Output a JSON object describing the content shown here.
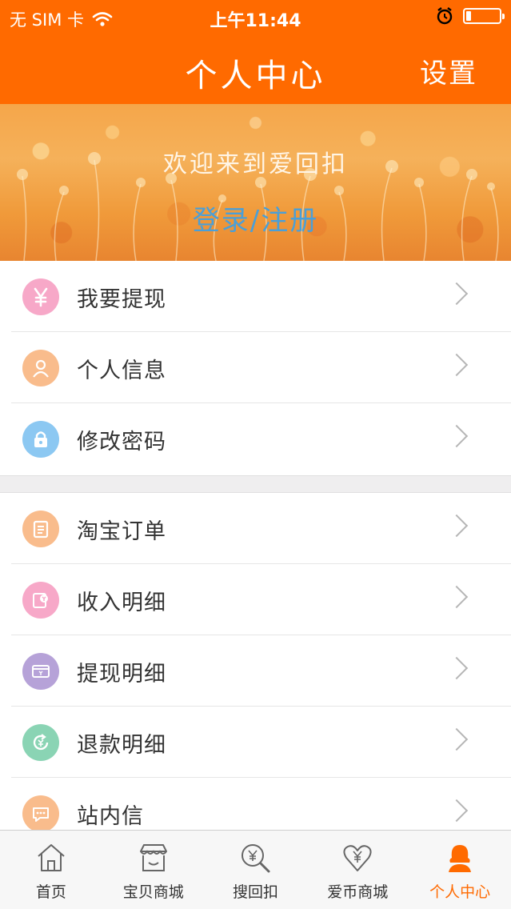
{
  "status_bar": {
    "carrier": "无 SIM 卡",
    "time": "上午11:44",
    "battery_level": 0.15
  },
  "nav": {
    "title": "个人中心",
    "settings_label": "设置"
  },
  "banner": {
    "welcome_text": "欢迎来到爱回扣",
    "login_label": "登录/注册"
  },
  "menu_group_1": [
    {
      "label": "我要提现",
      "icon": "yen-icon",
      "color": "#f7a8c8"
    },
    {
      "label": "个人信息",
      "icon": "user-icon",
      "color": "#f9bc8c"
    },
    {
      "label": "修改密码",
      "icon": "lock-icon",
      "color": "#8cc8f2"
    }
  ],
  "menu_group_2": [
    {
      "label": "淘宝订单",
      "icon": "clipboard-icon",
      "color": "#f9bc8c"
    },
    {
      "label": "收入明细",
      "icon": "income-icon",
      "color": "#f7a8c8"
    },
    {
      "label": "提现明细",
      "icon": "card-icon",
      "color": "#b6a2d8"
    },
    {
      "label": "退款明细",
      "icon": "refund-icon",
      "color": "#8ad4b4"
    },
    {
      "label": "站内信",
      "icon": "message-icon",
      "color": "#f9bc8c"
    }
  ],
  "tab_bar": [
    {
      "label": "首页",
      "icon": "home-icon"
    },
    {
      "label": "宝贝商城",
      "icon": "shop-icon"
    },
    {
      "label": "搜回扣",
      "icon": "search-yen-icon"
    },
    {
      "label": "爱币商城",
      "icon": "heart-yen-icon"
    },
    {
      "label": "个人中心",
      "icon": "person-icon",
      "active": true
    }
  ],
  "colors": {
    "brand": "#ff6a00",
    "login_link": "#4a9fd8",
    "tab_active": "#ff6a00"
  }
}
